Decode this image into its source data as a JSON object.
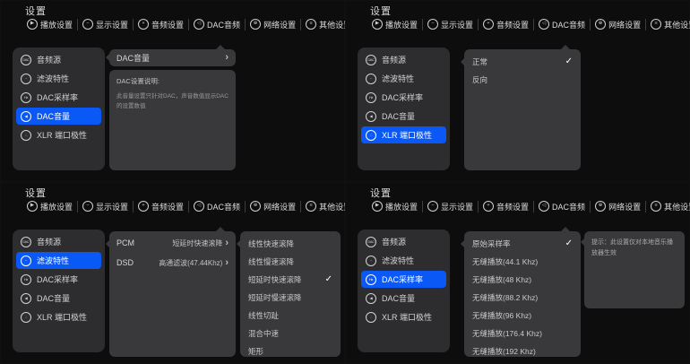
{
  "colors": {
    "accent": "#0a59f7",
    "panel": "#39393b",
    "sidebar_panel": "#2d2d2f",
    "background": "#0d0d0e"
  },
  "glyphs": {
    "check": "✓",
    "chevron_right": "›"
  },
  "header": {
    "title": "设置"
  },
  "tabs": [
    {
      "label": "播放设置",
      "glyph": "▶"
    },
    {
      "label": "显示设置",
      "glyph": "−"
    },
    {
      "label": "音频设置",
      "glyph": "+"
    },
    {
      "label": "DAC音频",
      "glyph": "◁"
    },
    {
      "label": "网络设置",
      "glyph": "⊕"
    },
    {
      "label": "其他设置",
      "glyph": "≡"
    }
  ],
  "sidebar": {
    "items": [
      {
        "label": "音频源",
        "glyph": "DAC"
      },
      {
        "label": "滤波特性",
        "glyph": "~"
      },
      {
        "label": "DAC采样率",
        "glyph": "Hz"
      },
      {
        "label": "DAC音量",
        "glyph": "◀"
      },
      {
        "label": "XLR 端口极性",
        "glyph": "∴"
      }
    ]
  },
  "screens": {
    "dac_volume": {
      "selected_sidebar": "DAC音量",
      "row_label": "DAC音量",
      "desc_title": "DAC设置说明:",
      "desc_body": "此音量设置只针对DAC，声音数值显示DAC的设置数值"
    },
    "xlr_polarity": {
      "selected_sidebar": "XLR 端口极性",
      "options": [
        {
          "label": "正常",
          "checked": true
        },
        {
          "label": "反向",
          "checked": false
        }
      ]
    },
    "filter": {
      "selected_sidebar": "滤波特性",
      "rows": [
        {
          "label": "PCM",
          "value": "短延时快速滚降"
        },
        {
          "label": "DSD",
          "value": "高通滤波(47.44Khz)"
        }
      ],
      "options": [
        {
          "label": "线性快速滚降",
          "checked": false
        },
        {
          "label": "线性慢速滚降",
          "checked": false
        },
        {
          "label": "短延时快速滚降",
          "checked": true
        },
        {
          "label": "短延时慢速滚降",
          "checked": false
        },
        {
          "label": "线性切趾",
          "checked": false
        },
        {
          "label": "混合中速",
          "checked": false
        },
        {
          "label": "矩形",
          "checked": false
        }
      ]
    },
    "samplerate": {
      "selected_sidebar": "DAC采样率",
      "options": [
        {
          "label": "原始采样率",
          "checked": true
        },
        {
          "label": "无缝播放(44.1 Khz)",
          "checked": false
        },
        {
          "label": "无缝播放(48 Khz)",
          "checked": false
        },
        {
          "label": "无缝播放(88.2 Khz)",
          "checked": false
        },
        {
          "label": "无缝播放(96 Khz)",
          "checked": false
        },
        {
          "label": "无缝播放(176.4 Khz)",
          "checked": false
        },
        {
          "label": "无缝播放(192 Khz)",
          "checked": false
        }
      ],
      "tip": "提示：此设置仅对本地音乐播放器生效"
    }
  }
}
